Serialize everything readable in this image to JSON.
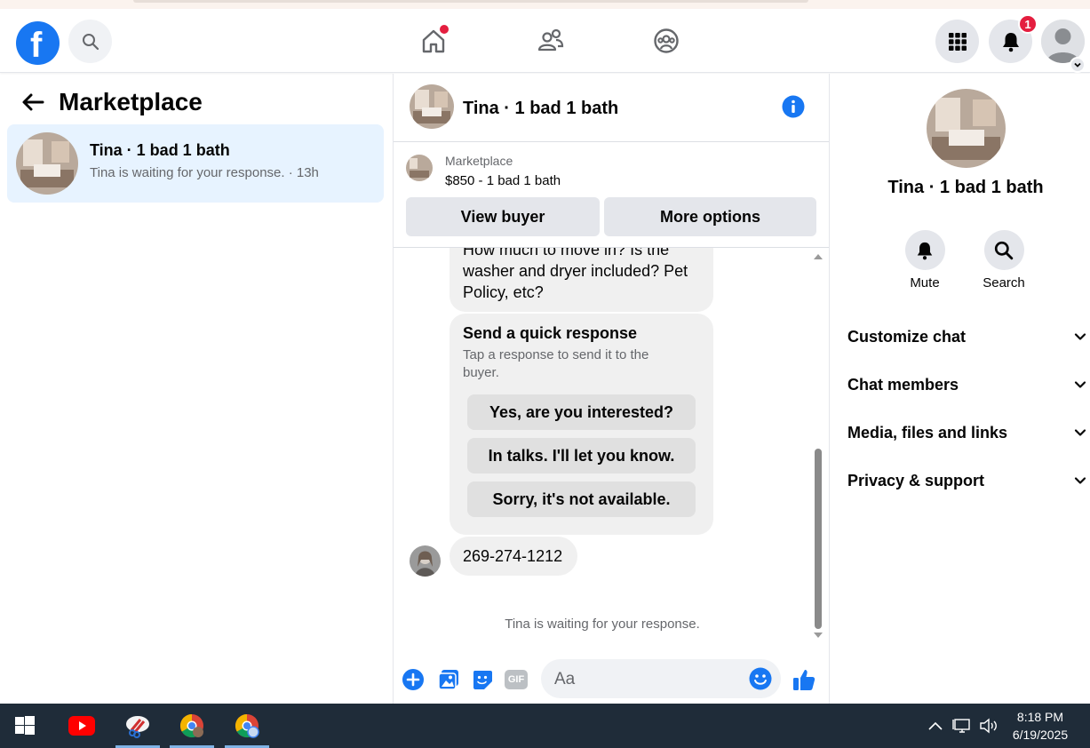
{
  "header": {
    "logo_letter": "f",
    "notification_count": "1"
  },
  "left": {
    "title": "Marketplace",
    "conversations": [
      {
        "name": "Tina · 1 bad 1 bath",
        "preview": "Tina is waiting for your response. · 13h"
      }
    ]
  },
  "chat": {
    "title": "Tina · 1 bad 1 bath",
    "listing": {
      "label": "Marketplace",
      "price_title": "$850 - 1 bad 1 bath"
    },
    "view_buyer_label": "View buyer",
    "more_options_label": "More options",
    "messages": {
      "partial_line1": "How much to move in? Is the",
      "partial_line2": "washer and dryer included? Pet",
      "partial_line3": "Policy, etc?",
      "quick_title": "Send a quick response",
      "quick_sub": "Tap a response to send it to the buyer.",
      "quick_replies": [
        "Yes, are you interested?",
        "In talks. I'll let you know.",
        "Sorry, it's not available."
      ],
      "buyer_reply": "269-274-1212"
    },
    "waiting_text": "Tina is waiting for your response.",
    "composer_placeholder": "Aa",
    "gif_label": "GIF"
  },
  "details": {
    "name": "Tina · 1 bad 1 bath",
    "mute_label": "Mute",
    "search_label": "Search",
    "menu": [
      "Customize chat",
      "Chat members",
      "Media, files and links",
      "Privacy & support"
    ]
  },
  "taskbar": {
    "time": "8:18 PM",
    "date": "6/19/2025"
  },
  "colors": {
    "brand_blue": "#1877f2",
    "selected_bg": "#e7f3ff",
    "badge_red": "#e41e3f",
    "taskbar_bg": "#1f2c39"
  }
}
